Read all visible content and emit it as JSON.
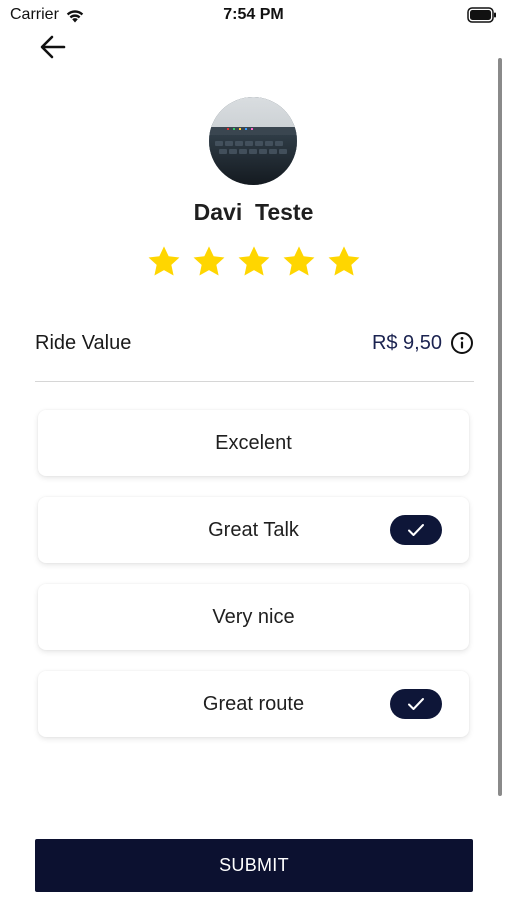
{
  "status_bar": {
    "carrier": "Carrier",
    "time": "7:54 PM"
  },
  "header": {
    "back_icon": "arrow-left-icon"
  },
  "driver": {
    "name": "Davi  Teste",
    "rating": 5,
    "rating_max": 5,
    "star_color": "#FFD600"
  },
  "ride": {
    "label": "Ride Value",
    "amount": "R$ 9,50",
    "amount_color": "#1B2350"
  },
  "options": [
    {
      "label": "Excelent",
      "selected": false
    },
    {
      "label": "Great Talk",
      "selected": true
    },
    {
      "label": "Very nice",
      "selected": false
    },
    {
      "label": "Great route",
      "selected": true
    }
  ],
  "submit": {
    "label": "SUBMIT",
    "background": "#0C1130"
  }
}
